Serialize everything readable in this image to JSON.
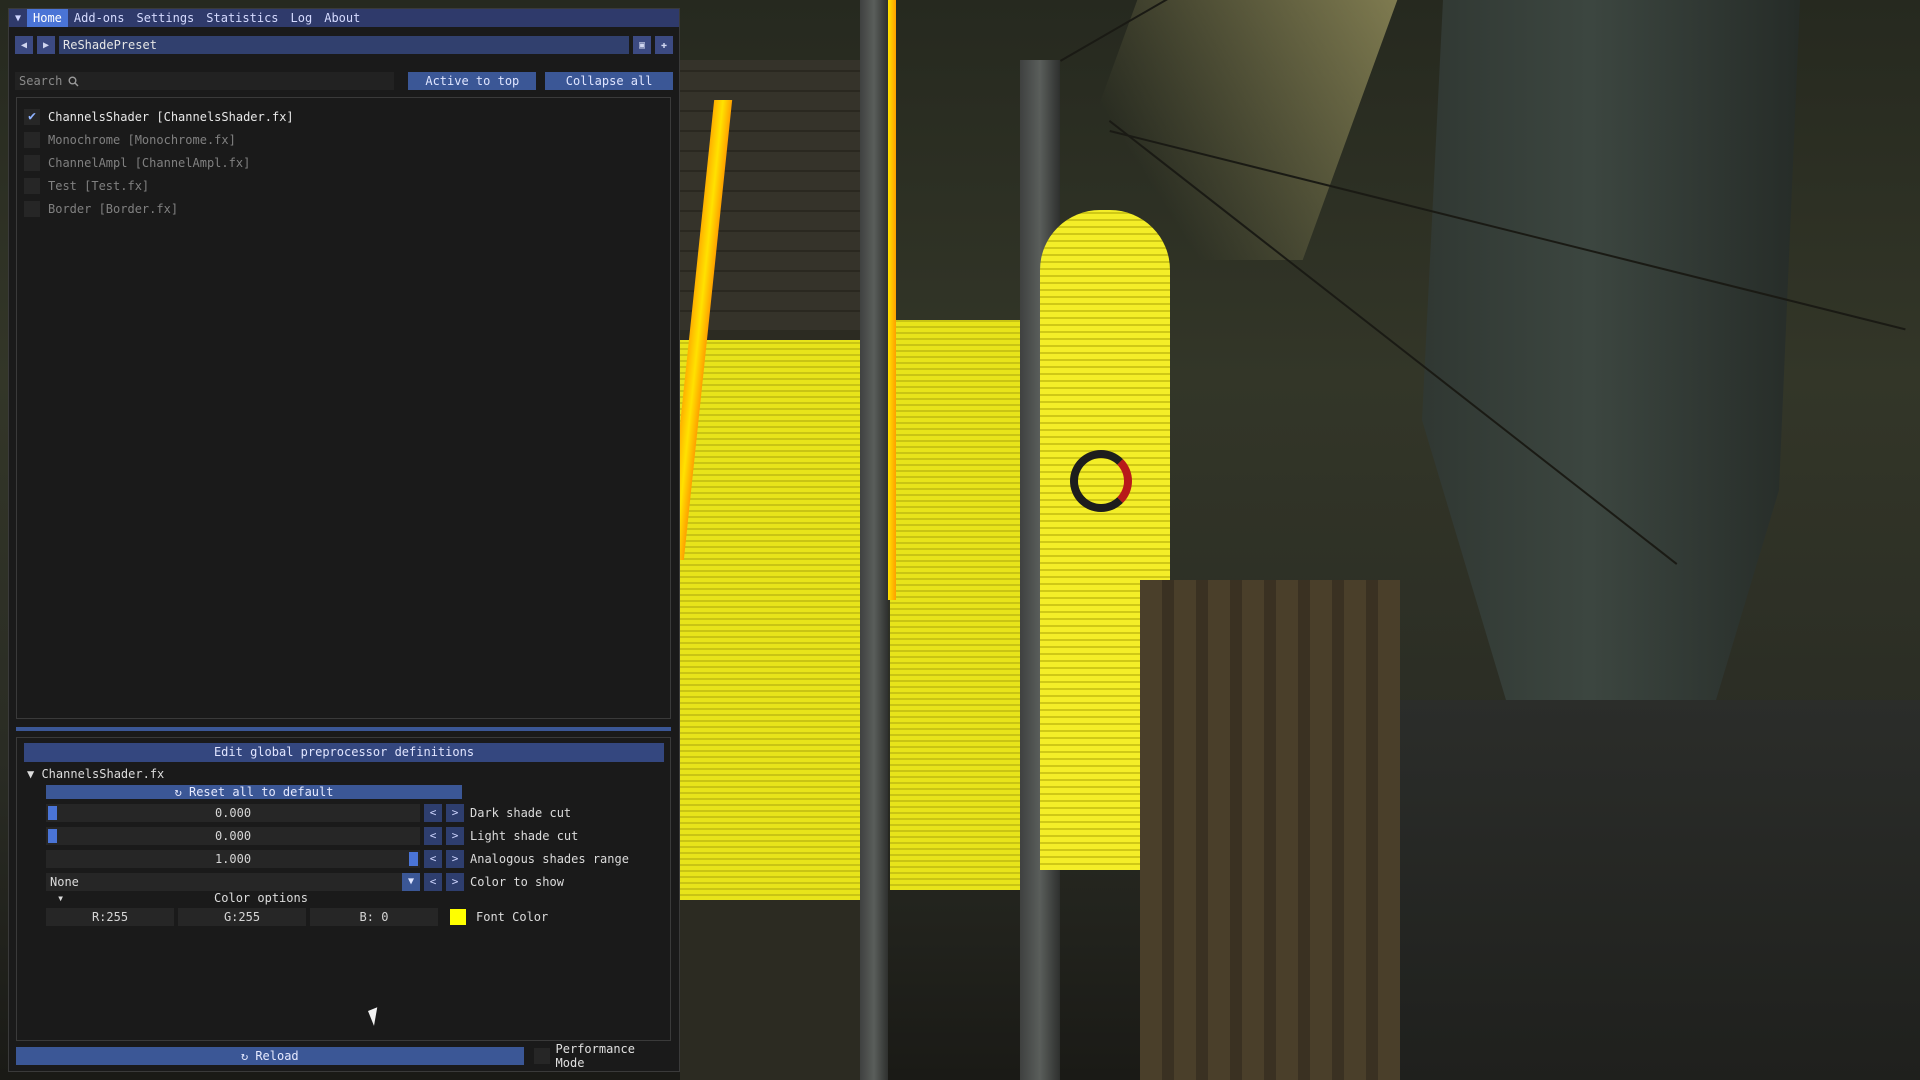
{
  "menu": {
    "toggle_icon": "caret-down-icon",
    "items": [
      {
        "label": "Home",
        "active": true
      },
      {
        "label": "Add-ons",
        "active": false
      },
      {
        "label": "Settings",
        "active": false
      },
      {
        "label": "Statistics",
        "active": false
      },
      {
        "label": "Log",
        "active": false
      },
      {
        "label": "About",
        "active": false
      }
    ]
  },
  "preset": {
    "name": "ReShadePreset"
  },
  "search": {
    "placeholder": "Search",
    "active_to_top_label": "Active to top",
    "collapse_all_label": "Collapse all"
  },
  "effects": [
    {
      "label": "ChannelsShader [ChannelsShader.fx]",
      "enabled": true
    },
    {
      "label": "Monochrome [Monochrome.fx]",
      "enabled": false
    },
    {
      "label": "ChannelAmpl [ChannelAmpl.fx]",
      "enabled": false
    },
    {
      "label": "Test [Test.fx]",
      "enabled": false
    },
    {
      "label": "Border [Border.fx]",
      "enabled": false
    }
  ],
  "params": {
    "edit_global_label": "Edit global preprocessor definitions",
    "shader_file": "ChannelsShader.fx",
    "reset_label": "Reset all to default",
    "dark_shade_cut": {
      "value": "0.000",
      "fraction": 0.0,
      "label": "Dark shade cut"
    },
    "light_shade_cut": {
      "value": "0.000",
      "fraction": 0.0,
      "label": "Light shade cut"
    },
    "analogous_shades_range": {
      "value": "1.000",
      "fraction": 1.0,
      "label": "Analogous shades range"
    },
    "color_to_show": {
      "value": "None",
      "label": "Color to show"
    },
    "color_options_label": "Color options",
    "font_color": {
      "r": "R:255",
      "g": "G:255",
      "b": "B:  0",
      "label": "Font Color",
      "swatch": "#ffff00"
    },
    "arrow_left": "<",
    "arrow_right": ">"
  },
  "footer": {
    "reload_label": "Reload",
    "performance_mode_label": "Performance Mode"
  },
  "colors": {
    "accent": "#4a74d6",
    "menubar": "#2f3a6b",
    "button": "#3b5796"
  }
}
